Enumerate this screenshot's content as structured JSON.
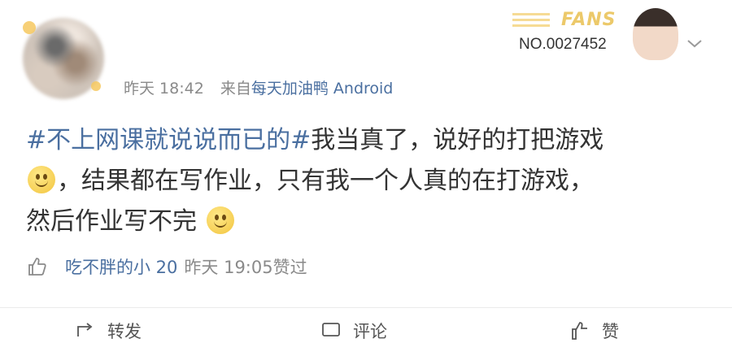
{
  "post": {
    "time": "昨天 18:42",
    "source_prefix": "来自",
    "source_app": "每天加油鸭 Android",
    "hashtag": "#不上网课就说说而已的#",
    "text_1": "我当真了，说好的打把游戏",
    "text_2": "，结果都在写作业，只有我一个人真的在打游戏，",
    "text_3": "然后作业写不完",
    "emoji": "smile-emoji"
  },
  "fans_badge": {
    "label": "FANS",
    "number": "NO.0027452"
  },
  "like_info": {
    "user": "吃不胖的小 20",
    "time": "昨天 19:05",
    "action": "赞过"
  },
  "actions": {
    "repost": "转发",
    "comment": "评论",
    "like": "赞"
  },
  "colors": {
    "link": "#4a6fa0",
    "meta": "#8a8a8a",
    "text": "#333333",
    "badge_gold": "#ecc96a"
  }
}
